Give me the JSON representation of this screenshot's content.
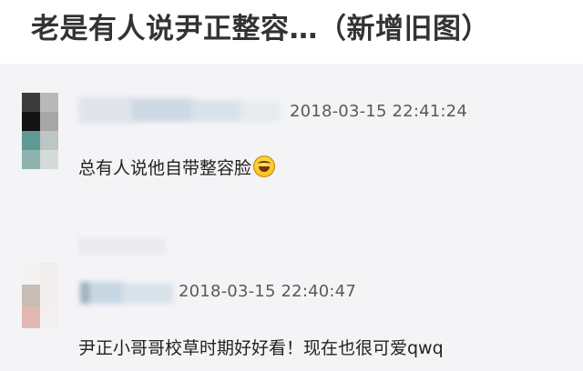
{
  "title": "老是有人说尹正整容…（新增旧图）",
  "comments": [
    {
      "timestamp": "2018-03-15 22:41:24",
      "text": "总有人说他自带整容脸",
      "emoji": "laughing-tears-emoji"
    },
    {
      "timestamp": "2018-03-15 22:40:47",
      "text": "尹正小哥哥校草时期好好看！现在也很可爱qwq"
    }
  ]
}
